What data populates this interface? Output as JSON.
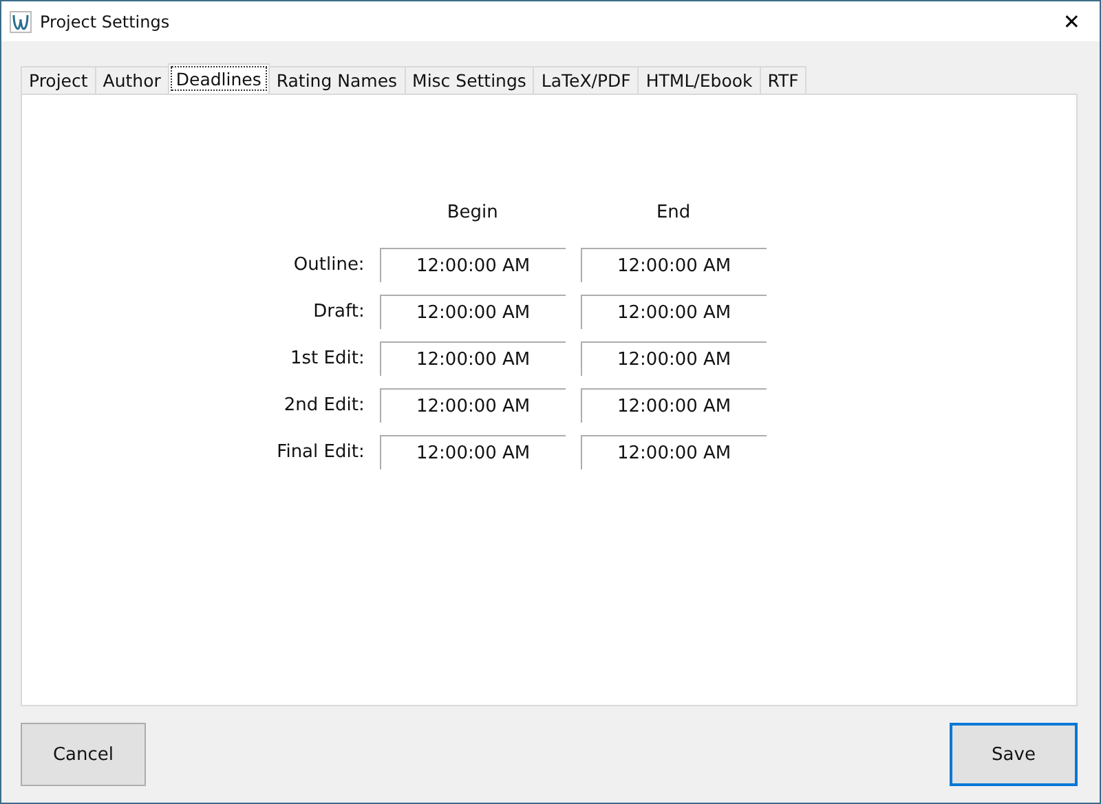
{
  "window": {
    "title": "Project Settings",
    "close": "✕"
  },
  "tabs": [
    {
      "label": "Project",
      "selected": false
    },
    {
      "label": "Author",
      "selected": false
    },
    {
      "label": "Deadlines",
      "selected": true
    },
    {
      "label": "Rating Names",
      "selected": false
    },
    {
      "label": "Misc Settings",
      "selected": false
    },
    {
      "label": "LaTeX/PDF",
      "selected": false
    },
    {
      "label": "HTML/Ebook",
      "selected": false
    },
    {
      "label": "RTF",
      "selected": false
    }
  ],
  "deadlines": {
    "columns": [
      "Begin",
      "End"
    ],
    "rows": [
      {
        "label": "Outline:",
        "begin": "12:00:00 AM",
        "end": "12:00:00 AM"
      },
      {
        "label": "Draft:",
        "begin": "12:00:00 AM",
        "end": "12:00:00 AM"
      },
      {
        "label": "1st Edit:",
        "begin": "12:00:00 AM",
        "end": "12:00:00 AM"
      },
      {
        "label": "2nd Edit:",
        "begin": "12:00:00 AM",
        "end": "12:00:00 AM"
      },
      {
        "label": "Final Edit:",
        "begin": "12:00:00 AM",
        "end": "12:00:00 AM"
      }
    ]
  },
  "buttons": [
    {
      "label": "Cancel",
      "default": false
    },
    {
      "label": "Save",
      "default": true
    }
  ]
}
